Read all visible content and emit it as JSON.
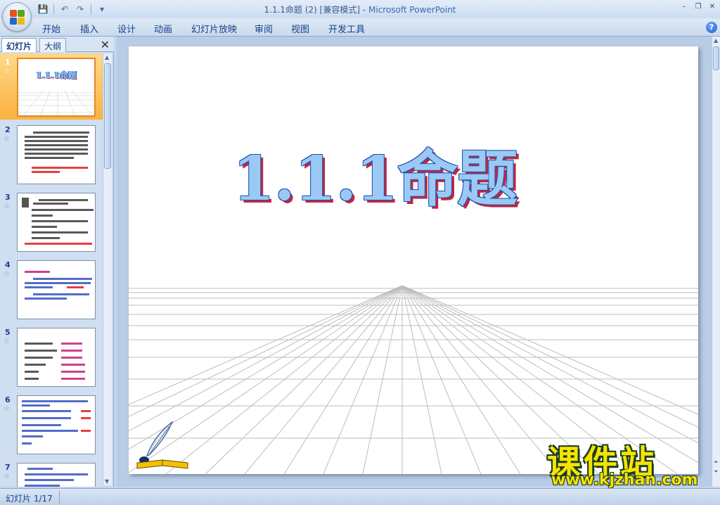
{
  "window": {
    "title_doc": "1.1.1命题 (2) [兼容模式]",
    "title_sep": " - ",
    "title_app": "Microsoft PowerPoint"
  },
  "qat": {
    "save": "💾",
    "undo": "↶",
    "redo": "↷",
    "customize": "▾"
  },
  "ribbon": {
    "tabs": [
      "开始",
      "插入",
      "设计",
      "动画",
      "幻灯片放映",
      "审阅",
      "视图",
      "开发工具"
    ],
    "help": "?"
  },
  "pane": {
    "tab_slides": "幻灯片",
    "tab_outline": "大纲",
    "close": "✕",
    "thumbnails": [
      {
        "num": "1",
        "title": "1.1.1命题"
      },
      {
        "num": "2"
      },
      {
        "num": "3"
      },
      {
        "num": "4"
      },
      {
        "num": "5"
      },
      {
        "num": "6"
      },
      {
        "num": "7"
      }
    ]
  },
  "slide": {
    "title": "1.1.1命题"
  },
  "watermark": {
    "big": "课件站",
    "small": "www.kjzhan.com"
  },
  "status": {
    "slide_counter": "幻灯片 1/17"
  },
  "colors": {
    "ribbon_bg": "#c9daef",
    "selected_thumb": "#fbb23e",
    "title_fill": "#9cc9f3",
    "title_outline": "#1a56b8",
    "title_shadow": "#c4263a",
    "watermark_fill": "#f5e400"
  }
}
